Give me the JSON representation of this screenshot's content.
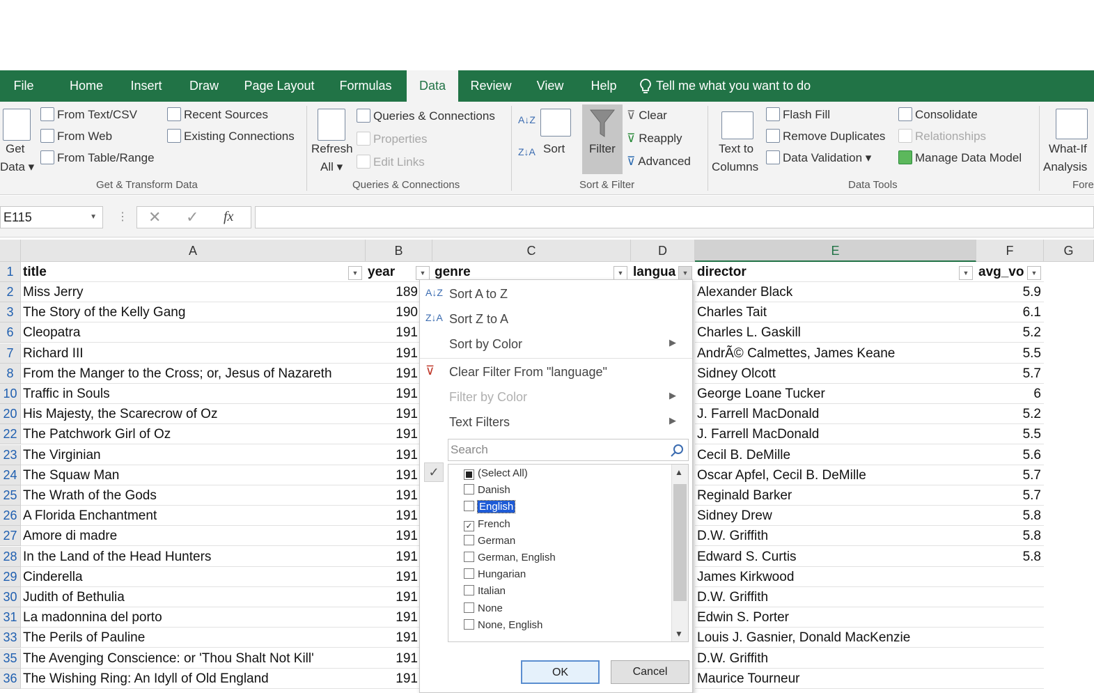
{
  "ribbon_tabs": [
    "File",
    "Home",
    "Insert",
    "Draw",
    "Page Layout",
    "Formulas",
    "Data",
    "Review",
    "View",
    "Help"
  ],
  "active_tab": "Data",
  "tell_me": "Tell me what you want to do",
  "get_transform": {
    "get_data": "Get",
    "get_data2": "Data",
    "from_text": "From Text/CSV",
    "from_web": "From Web",
    "from_table": "From Table/Range",
    "recent_sources": "Recent Sources",
    "existing_connections": "Existing Connections",
    "group": "Get & Transform Data"
  },
  "queries": {
    "refresh": "Refresh",
    "refresh2": "All",
    "queries_connections": "Queries & Connections",
    "properties": "Properties",
    "edit_links": "Edit Links",
    "group": "Queries & Connections"
  },
  "sort_filter": {
    "sort": "Sort",
    "filter": "Filter",
    "clear": "Clear",
    "reapply": "Reapply",
    "advanced": "Advanced",
    "group": "Sort & Filter"
  },
  "data_tools": {
    "text_to": "Text to",
    "columns": "Columns",
    "flash_fill": "Flash Fill",
    "remove_duplicates": "Remove Duplicates",
    "data_validation": "Data Validation",
    "consolidate": "Consolidate",
    "relationships": "Relationships",
    "manage_model": "Manage Data Model",
    "group": "Data Tools"
  },
  "forecast": {
    "what_if": "What-If",
    "analysis": "Analysis",
    "group": "Fore"
  },
  "name_box": "E115",
  "columns": [
    {
      "id": "A",
      "label": "A"
    },
    {
      "id": "B",
      "label": "B"
    },
    {
      "id": "C",
      "label": "C"
    },
    {
      "id": "D",
      "label": "D"
    },
    {
      "id": "E",
      "label": "E"
    },
    {
      "id": "F",
      "label": "F"
    },
    {
      "id": "G",
      "label": "G"
    }
  ],
  "headers": {
    "title": "title",
    "year": "year",
    "genre": "genre",
    "language": "langua",
    "director": "director",
    "avg": "avg_vo"
  },
  "rows": [
    {
      "n": "2",
      "title": "Miss Jerry",
      "year": "189",
      "director": "Alexander Black",
      "avg": "5.9"
    },
    {
      "n": "3",
      "title": "The Story of the Kelly Gang",
      "year": "190",
      "director": "Charles Tait",
      "avg": "6.1"
    },
    {
      "n": "6",
      "title": "Cleopatra",
      "year": "191",
      "director": "Charles L. Gaskill",
      "avg": "5.2"
    },
    {
      "n": "7",
      "title": "Richard III",
      "year": "191",
      "director": "AndrÃ© Calmettes, James Keane",
      "avg": "5.5"
    },
    {
      "n": "8",
      "title": "From the Manger to the Cross; or, Jesus of Nazareth",
      "year": "191",
      "director": "Sidney Olcott",
      "avg": "5.7"
    },
    {
      "n": "10",
      "title": "Traffic in Souls",
      "year": "191",
      "director": "George Loane Tucker",
      "avg": "6"
    },
    {
      "n": "20",
      "title": "His Majesty, the Scarecrow of Oz",
      "year": "191",
      "director": "J. Farrell MacDonald",
      "avg": "5.2"
    },
    {
      "n": "22",
      "title": "The Patchwork Girl of Oz",
      "year": "191",
      "director": "J. Farrell MacDonald",
      "avg": "5.5"
    },
    {
      "n": "23",
      "title": "The Virginian",
      "year": "191",
      "director": "Cecil B. DeMille",
      "avg": "5.6"
    },
    {
      "n": "24",
      "title": "The Squaw Man",
      "year": "191",
      "director": "Oscar Apfel, Cecil B. DeMille",
      "avg": "5.7"
    },
    {
      "n": "25",
      "title": "The Wrath of the Gods",
      "year": "191",
      "director": "Reginald Barker",
      "avg": "5.7"
    },
    {
      "n": "26",
      "title": "A Florida Enchantment",
      "year": "191",
      "director": "Sidney Drew",
      "avg": "5.8"
    },
    {
      "n": "27",
      "title": "Amore di madre",
      "year": "191",
      "director": "D.W. Griffith",
      "avg": "5.8"
    },
    {
      "n": "28",
      "title": "In the Land of the Head Hunters",
      "year": "191",
      "director": "Edward S. Curtis",
      "avg": "5.8"
    },
    {
      "n": "29",
      "title": "Cinderella",
      "year": "191",
      "director": "James Kirkwood",
      "avg": ""
    },
    {
      "n": "30",
      "title": "Judith of Bethulia",
      "year": "191",
      "director": "D.W. Griffith",
      "avg": ""
    },
    {
      "n": "31",
      "title": "La madonnina del porto",
      "year": "191",
      "director": "Edwin S. Porter",
      "avg": ""
    },
    {
      "n": "33",
      "title": "The Perils of Pauline",
      "year": "191",
      "director": "Louis J. Gasnier, Donald MacKenzie",
      "avg": ""
    },
    {
      "n": "35",
      "title": "The Avenging Conscience: or 'Thou Shalt Not Kill'",
      "year": "191",
      "director": "D.W. Griffith",
      "avg": ""
    },
    {
      "n": "36",
      "title": "The Wishing Ring: An Idyll of Old England",
      "year": "191",
      "director": "Maurice Tourneur",
      "avg": ""
    }
  ],
  "filter_menu": {
    "sort_az": "Sort A to Z",
    "sort_za": "Sort Z to A",
    "sort_color": "Sort by Color",
    "clear_filter": "Clear Filter From \"language\"",
    "filter_color": "Filter by Color",
    "text_filters": "Text Filters",
    "search_placeholder": "Search",
    "items": [
      {
        "label": "(Select All)",
        "state": "partial"
      },
      {
        "label": "Danish",
        "state": "unchecked"
      },
      {
        "label": "English",
        "state": "unchecked",
        "highlight": true
      },
      {
        "label": "French",
        "state": "checked"
      },
      {
        "label": "German",
        "state": "unchecked"
      },
      {
        "label": "German, English",
        "state": "unchecked"
      },
      {
        "label": "Hungarian",
        "state": "unchecked"
      },
      {
        "label": "Italian",
        "state": "unchecked"
      },
      {
        "label": "None",
        "state": "unchecked"
      },
      {
        "label": "None, English",
        "state": "unchecked"
      }
    ],
    "ok": "OK",
    "cancel": "Cancel"
  },
  "colors": {
    "excel_green": "#217346",
    "link_blue": "#1f5fb0",
    "highlight": "#1e5bd6"
  }
}
